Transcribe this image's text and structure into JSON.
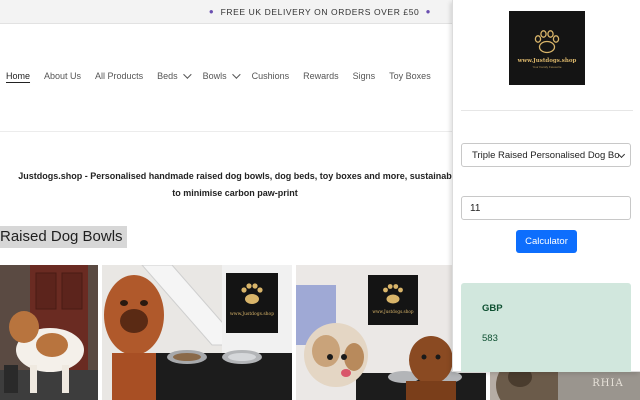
{
  "announcement": {
    "text": "FREE UK DELIVERY ON ORDERS OVER £50"
  },
  "nav": {
    "items": [
      {
        "label": "Home",
        "active": true,
        "dropdown": false
      },
      {
        "label": "About Us",
        "active": false,
        "dropdown": false
      },
      {
        "label": "All Products",
        "active": false,
        "dropdown": false
      },
      {
        "label": "Beds",
        "active": false,
        "dropdown": true
      },
      {
        "label": "Bowls",
        "active": false,
        "dropdown": true
      },
      {
        "label": "Cushions",
        "active": false,
        "dropdown": false
      },
      {
        "label": "Rewards",
        "active": false,
        "dropdown": false
      },
      {
        "label": "Signs",
        "active": false,
        "dropdown": false
      },
      {
        "label": "Toy Boxes",
        "active": false,
        "dropdown": false
      }
    ]
  },
  "tagline": {
    "line1": "Justdogs.shop - Personalised handmade raised dog bowls, dog beds, toy boxes and more, sustainab",
    "line2": "to minimise carbon paw-print"
  },
  "collection": {
    "title": "Raised Dog Bowls"
  },
  "products": {
    "logo_text": "www.Justdogs.shop",
    "sign_text": "RHIA"
  },
  "popup": {
    "logo_text": "www.Justdogs.shop",
    "logo_subtext": "Your Family Favourite",
    "select_value": "Triple Raised Personalised Dog Bo",
    "input_value": "11",
    "button_label": "Calculator",
    "result_currency": "GBP",
    "result_value": "583"
  },
  "colors": {
    "accent_button": "#0d6efd",
    "result_bg": "#d1e7dd",
    "logo_gold": "#d9b56a"
  }
}
